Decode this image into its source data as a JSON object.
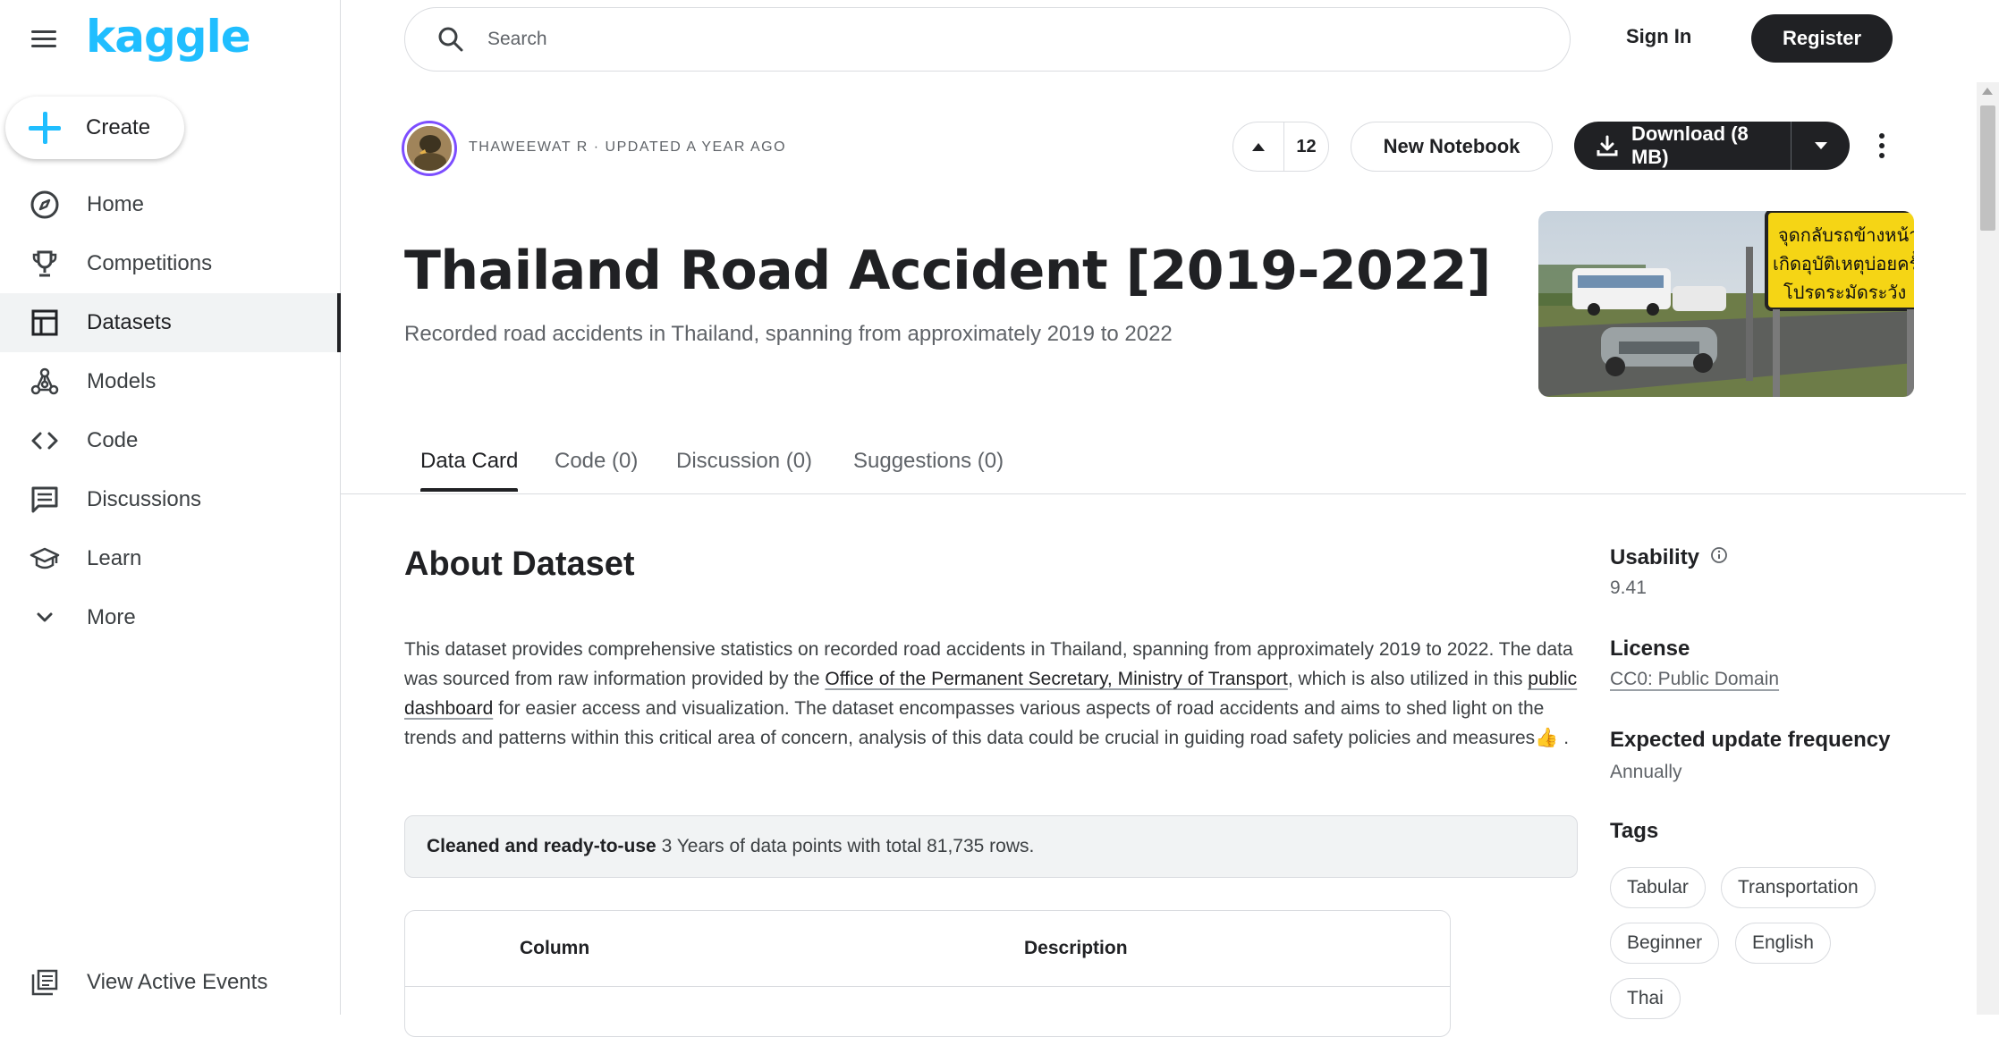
{
  "brand": {
    "logo_text": "kaggle",
    "accent": "#20beff"
  },
  "sidebar": {
    "create_label": "Create",
    "items": [
      {
        "label": "Home",
        "icon": "compass-icon",
        "active": false
      },
      {
        "label": "Competitions",
        "icon": "trophy-icon",
        "active": false
      },
      {
        "label": "Datasets",
        "icon": "table-icon",
        "active": true
      },
      {
        "label": "Models",
        "icon": "models-icon",
        "active": false
      },
      {
        "label": "Code",
        "icon": "code-icon",
        "active": false
      },
      {
        "label": "Discussions",
        "icon": "discussion-icon",
        "active": false
      },
      {
        "label": "Learn",
        "icon": "graduation-cap-icon",
        "active": false
      },
      {
        "label": "More",
        "icon": "chevron-down-icon",
        "active": false
      }
    ],
    "footer_label": "View Active Events"
  },
  "header": {
    "search_placeholder": "Search",
    "sign_in": "Sign In",
    "register": "Register"
  },
  "dataset": {
    "author_line": "THAWEEWAT R · UPDATED A YEAR AGO",
    "upvotes": "12",
    "new_notebook": "New Notebook",
    "download": "Download (8 MB)",
    "title": "Thailand Road Accident [2019-2022]",
    "subtitle": "Recorded road accidents in Thailand, spanning from approximately 2019 to 2022",
    "sign_text_line1": "จุดกลับรถข้างหน้า",
    "sign_text_line2": "เกิดอุบัติเหตุบ่อยครั้ง",
    "sign_text_line3": "โปรดระมัดระวัง"
  },
  "tabs": [
    {
      "label": "Data Card",
      "active": true
    },
    {
      "label": "Code (0)",
      "active": false
    },
    {
      "label": "Discussion (0)",
      "active": false
    },
    {
      "label": "Suggestions (0)",
      "active": false
    }
  ],
  "about": {
    "heading": "About Dataset",
    "p_part1": "This dataset provides comprehensive statistics on recorded road accidents in Thailand, spanning from approximately 2019 to 2022. The data was sourced from raw information provided by the ",
    "link1": "Office of the Permanent Secretary, Ministry of Transport",
    "p_part2": ", which is also utilized in this ",
    "link2": "public dashboard",
    "p_part3": " for easier access and visualization. The dataset encompasses various aspects of road accidents and aims to shed light on the trends and patterns within this critical area of concern, analysis of this data could be crucial in guiding road safety policies and measures",
    "emoji": "👍",
    "p_end": ".",
    "note_bold": "Cleaned and ready-to-use",
    "note_rest": " 3 Years of data points with total 81,735 rows.",
    "table_col1": "Column",
    "table_col2": "Description"
  },
  "meta": {
    "usability_label": "Usability",
    "usability_value": "9.41",
    "license_label": "License",
    "license_value": "CC0: Public Domain",
    "frequency_label": "Expected update frequency",
    "frequency_value": "Annually",
    "tags_label": "Tags",
    "tags": [
      "Tabular",
      "Transportation",
      "Beginner",
      "English",
      "Thai"
    ]
  }
}
